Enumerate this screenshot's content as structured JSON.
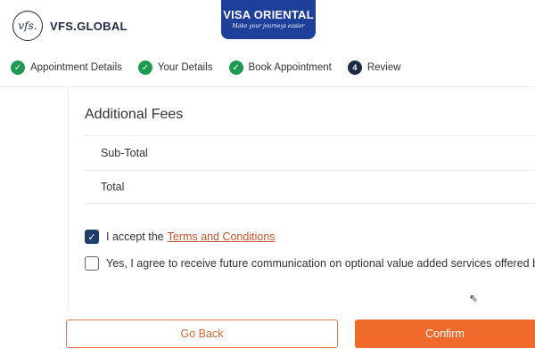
{
  "header": {
    "logo_mark": "vfs.",
    "logo_text": "VFS.GLOBAL",
    "partner_name": "VISA ORIENTAL",
    "partner_tagline": "Make your journeys easier"
  },
  "steps": [
    {
      "label": "Appointment Details",
      "status": "done"
    },
    {
      "label": "Your Details",
      "status": "done"
    },
    {
      "label": "Book Appointment",
      "status": "done"
    },
    {
      "label": "Review",
      "status": "current",
      "number": "4"
    }
  ],
  "fees": {
    "title": "Additional Fees",
    "rows": [
      {
        "label": "Sub-Total"
      },
      {
        "label": "Total"
      }
    ]
  },
  "consents": {
    "terms_prefix": "I accept the",
    "terms_link": "Terms and Conditions",
    "terms_checked": true,
    "marketing_text": "Yes, I agree to receive future communication on optional value added services offered by",
    "marketing_checked": false
  },
  "actions": {
    "back_label": "Go Back",
    "confirm_label": "Confirm"
  },
  "colors": {
    "accent": "#ef6a2b",
    "navy": "#1f2a44",
    "success": "#1e9a4f",
    "partner_blue": "#1e3f9a"
  }
}
